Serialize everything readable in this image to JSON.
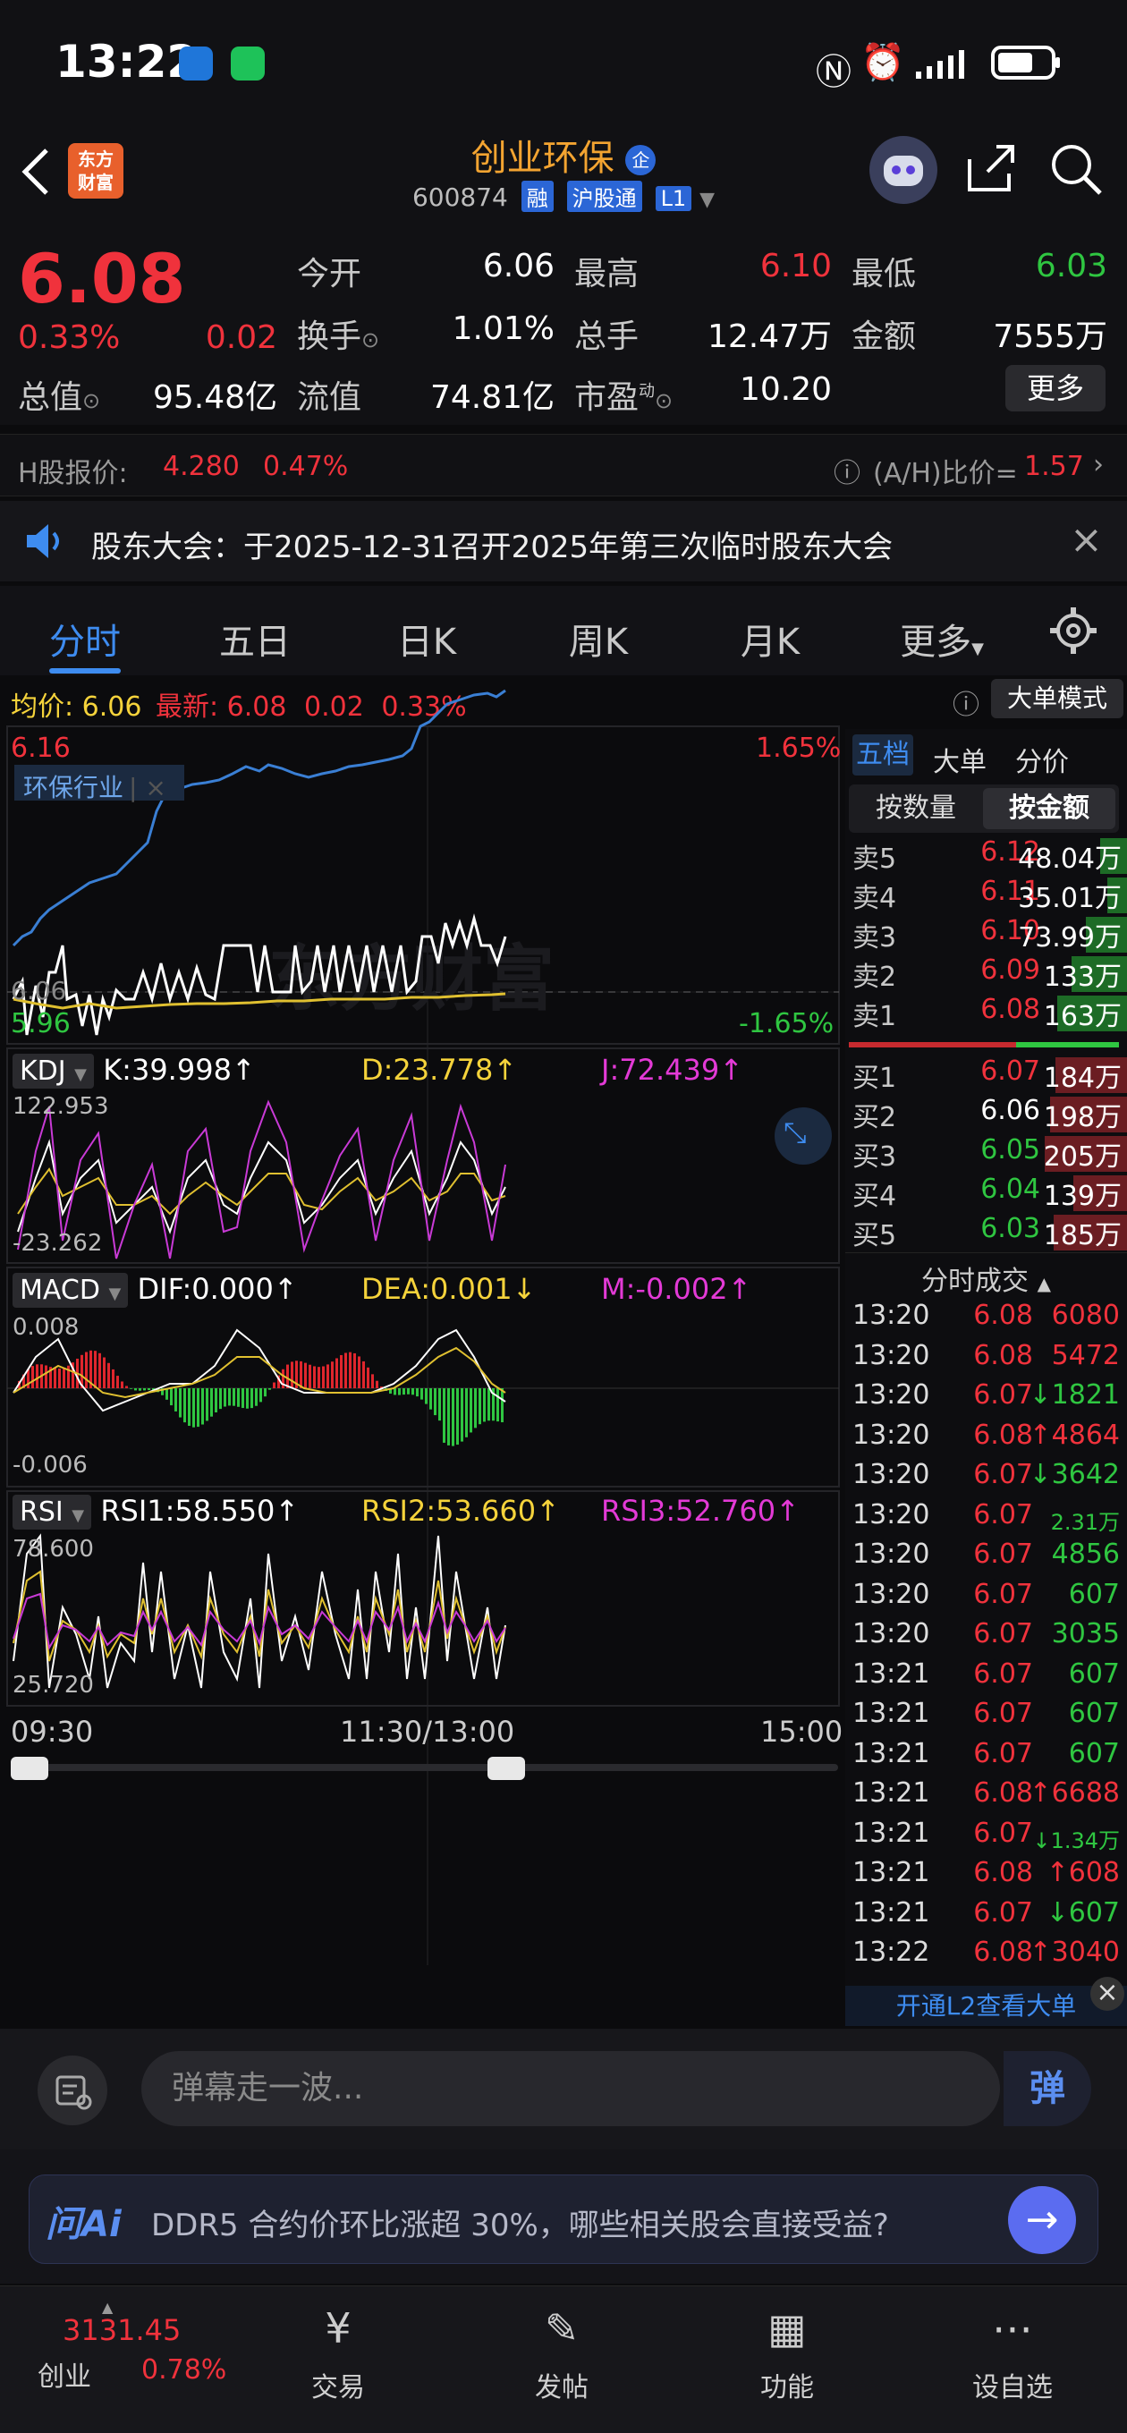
{
  "status_bar": {
    "time": "13:22"
  },
  "header": {
    "logo_text_line1": "东方",
    "logo_text_line2": "财富",
    "stock_name": "创业环保",
    "stock_code": "600874",
    "tags": [
      "融",
      "沪股通",
      "L1"
    ]
  },
  "quote": {
    "last_price": "6.08",
    "change_pct": "0.33%",
    "change": "0.02",
    "fields": [
      {
        "label": "今开",
        "value": "6.06"
      },
      {
        "label": "最高",
        "value": "6.10"
      },
      {
        "label": "最低",
        "value": "6.03"
      },
      {
        "label": "换手",
        "value": "1.01%"
      },
      {
        "label": "总手",
        "value": "12.47万"
      },
      {
        "label": "金额",
        "value": "7555万"
      },
      {
        "label": "总值",
        "value": "95.48亿"
      },
      {
        "label": "流值",
        "value": "74.81亿"
      },
      {
        "label": "市盈",
        "value": "10.20"
      }
    ],
    "pe_superscript": "动",
    "more_label": "更多"
  },
  "hshare": {
    "label": "H股报价:",
    "price": "4.280",
    "pct": "0.47%",
    "ratio_label": "(A/H)比价=",
    "ratio_value": "1.57"
  },
  "notice": {
    "text": "股东大会：于2025-12-31召开2025年第三次临时股东大会"
  },
  "tabs": [
    "分时",
    "五日",
    "日K",
    "周K",
    "月K",
    "更多"
  ],
  "chart_header": {
    "avg_label": "均价:",
    "avg_value": "6.06",
    "last_label": "最新:",
    "last_value": "6.08",
    "last_change": "0.02",
    "last_pct": "0.33%",
    "big_order_btn": "大单模式"
  },
  "main_chart": {
    "y_top": "6.16",
    "y_mid": "6.06",
    "y_bottom": "5.96",
    "pct_top": "1.65%",
    "pct_bottom": "-1.65%",
    "industry_tag": "环保行业",
    "watermark": "东方财富"
  },
  "indicators": {
    "kdj": {
      "name": "KDJ",
      "k": "K:39.998↑",
      "d": "D:23.778↑",
      "j": "J:72.439↑",
      "max": "122.953",
      "min": "-23.262"
    },
    "macd": {
      "name": "MACD",
      "dif": "DIF:0.000↑",
      "dea": "DEA:0.001↓",
      "m": "M:-0.002↑",
      "max": "0.008",
      "min": "-0.006"
    },
    "rsi": {
      "name": "RSI",
      "r1": "RSI1:58.550↑",
      "r2": "RSI2:53.660↑",
      "r3": "RSI3:52.760↑",
      "max": "78.600",
      "min": "25.720"
    }
  },
  "time_axis": {
    "start": "09:30",
    "mid": "11:30/13:00",
    "end": "15:00"
  },
  "orderbook": {
    "tabs": [
      "五档",
      "大单",
      "分价"
    ],
    "subtabs": [
      "按数量",
      "按金额"
    ],
    "asks": [
      {
        "label": "卖5",
        "price": "6.12",
        "vol": "48.04万"
      },
      {
        "label": "卖4",
        "price": "6.11",
        "vol": "35.01万"
      },
      {
        "label": "卖3",
        "price": "6.10",
        "vol": "73.99万"
      },
      {
        "label": "卖2",
        "price": "6.09",
        "vol": "133万"
      },
      {
        "label": "卖1",
        "price": "6.08",
        "vol": "163万"
      }
    ],
    "bids": [
      {
        "label": "买1",
        "price": "6.07",
        "vol": "184万"
      },
      {
        "label": "买2",
        "price": "6.06",
        "vol": "198万"
      },
      {
        "label": "买3",
        "price": "6.05",
        "vol": "205万"
      },
      {
        "label": "买4",
        "price": "6.04",
        "vol": "139万"
      },
      {
        "label": "买5",
        "price": "6.03",
        "vol": "185万"
      }
    ],
    "trades_title": "分时成交",
    "trades": [
      {
        "time": "13:20",
        "price": "6.08",
        "vol": "6080"
      },
      {
        "time": "13:20",
        "price": "6.08",
        "vol": "5472"
      },
      {
        "time": "13:20",
        "price": "6.07",
        "vol": "↓1821"
      },
      {
        "time": "13:20",
        "price": "6.08",
        "vol": "↑4864"
      },
      {
        "time": "13:20",
        "price": "6.07",
        "vol": "↓3642"
      },
      {
        "time": "13:20",
        "price": "6.07",
        "vol": "2.31万"
      },
      {
        "time": "13:20",
        "price": "6.07",
        "vol": "4856"
      },
      {
        "time": "13:20",
        "price": "6.07",
        "vol": "607"
      },
      {
        "time": "13:20",
        "price": "6.07",
        "vol": "3035"
      },
      {
        "time": "13:21",
        "price": "6.07",
        "vol": "607"
      },
      {
        "time": "13:21",
        "price": "6.07",
        "vol": "607"
      },
      {
        "time": "13:21",
        "price": "6.07",
        "vol": "607"
      },
      {
        "time": "13:21",
        "price": "6.08",
        "vol": "↑6688"
      },
      {
        "time": "13:21",
        "price": "6.07",
        "vol": "↓1.34万"
      },
      {
        "time": "13:21",
        "price": "6.08",
        "vol": "↑608"
      },
      {
        "time": "13:21",
        "price": "6.07",
        "vol": "↓607"
      },
      {
        "time": "13:22",
        "price": "6.08",
        "vol": "↑3040"
      }
    ],
    "l2_link": "开通L2查看大单"
  },
  "comment_bar": {
    "placeholder": "弹幕走一波...",
    "danmu_btn": "弹"
  },
  "ai_bar": {
    "brand": "问Ai",
    "question": "DDR5 合约价环比涨超 30%，哪些相关股会直接受益?"
  },
  "bottom_nav": {
    "index_value": "3131.45",
    "index_name": "创业",
    "index_pct": "0.78%",
    "items": [
      "交易",
      "发帖",
      "功能",
      "设自选"
    ]
  },
  "colors": {
    "up": "#f0323c",
    "down": "#2fc641",
    "accent": "#3e8cf0",
    "avg": "#f5d33b"
  }
}
